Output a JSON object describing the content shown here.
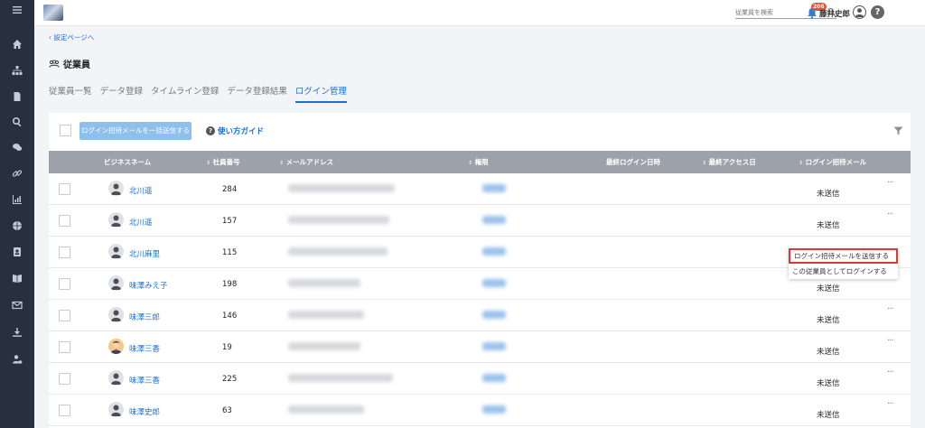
{
  "header": {
    "search_placeholder": "従業員を検索",
    "notification_count": "206",
    "user_name": "藤井史郎",
    "help_label": "?"
  },
  "sidebar": {
    "icons": [
      "menu-icon",
      "home-icon",
      "org-chart-icon",
      "document-icon",
      "search-icon",
      "chat-icon",
      "link-icon",
      "chart-icon",
      "globe-icon",
      "profile-card-icon",
      "book-icon",
      "mail-icon",
      "download-icon",
      "user-settings-icon"
    ]
  },
  "page": {
    "back_link": "‹ 設定ページへ",
    "title": "従業員",
    "tabs": [
      {
        "label": "従業員一覧"
      },
      {
        "label": "データ登録"
      },
      {
        "label": "タイムライン登録"
      },
      {
        "label": "データ登録結果"
      },
      {
        "label": "ログイン管理",
        "active": true
      }
    ]
  },
  "toolbar": {
    "invite_all_button": "ログイン招待メールを一括送信する",
    "guide_link": "使い方ガイド"
  },
  "table": {
    "columns": [
      "ビジネスネーム",
      "社員番号",
      "メールアドレス",
      "権限",
      "最終ログイン日時",
      "最終アクセス日",
      "ログイン招待メール"
    ],
    "rows": [
      {
        "name": "北川遥",
        "emp_no": "284",
        "status": "未送信",
        "more": "···"
      },
      {
        "name": "北川遥",
        "emp_no": "157",
        "status": "未送信",
        "more": "···"
      },
      {
        "name": "北川麻里",
        "emp_no": "115",
        "status": "",
        "more": ""
      },
      {
        "name": "味澤みえ子",
        "emp_no": "198",
        "status": "未送信",
        "more": ""
      },
      {
        "name": "味澤三郎",
        "emp_no": "146",
        "status": "未送信",
        "more": "···"
      },
      {
        "name": "味澤三香",
        "emp_no": "19",
        "status": "未送信",
        "more": "···"
      },
      {
        "name": "味澤三香",
        "emp_no": "225",
        "status": "未送信",
        "more": "···"
      },
      {
        "name": "味澤史郎",
        "emp_no": "63",
        "status": "未送信",
        "more": "···"
      }
    ]
  },
  "context_menu": {
    "items": [
      "ログイン招待メールを送信する",
      "この従業員としてログインする"
    ]
  },
  "colors": {
    "sidebar": "#26303f",
    "accent": "#1a6fcf",
    "table_header": "#9da1aa",
    "disabled_button": "#8dc0ec",
    "highlight": "#d93a3a",
    "badge": "#e0533d"
  }
}
